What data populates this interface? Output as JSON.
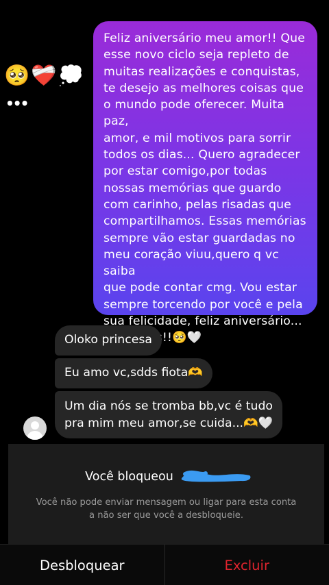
{
  "reactions": {
    "emojis": [
      "🥺",
      "❤️‍🩹",
      "💭"
    ],
    "more": "•••"
  },
  "outgoing_message": {
    "text": "Feliz aniversário meu amor!! Que\nesse novo ciclo seja repleto de\nmuitas realizações e conquistas,\nte desejo as melhores coisas que\no mundo pode oferecer. Muita paz,\namor, e mil motivos para sorrir\ntodos os dias... Quero agradecer\npor estar comigo,por todas\nnossas memórias que guardo\ncom carinho, pelas risadas que\ncompartilhamos. Essas memórias\nsempre vão estar guardadas no\nmeu coração viuu,quero q vc saiba\nque pode contar cmg. Vou estar\nsempre torcendo por você e pela\nsua felicidade, feliz aniversário...\nSaudades!!🥺🤍",
    "gradient_top": "#9a2bd8",
    "gradient_bottom": "#5a44ee"
  },
  "incoming_messages": [
    {
      "text": "Oloko princesa"
    },
    {
      "text": "Eu amo vc,sdds fiota🫶"
    },
    {
      "text": "Um dia nós  se tromba bb,vc é tudo\npra mim meu amor,se cuida...🫶🤍"
    }
  ],
  "blocked_notice": {
    "title": "Você bloqueou",
    "description": "Você não pode enviar mensagem ou ligar para esta conta\na não ser que você a desbloqueie.",
    "scribble_color": "#3b9bf2"
  },
  "actions": {
    "unblock_label": "Desbloquear",
    "delete_label": "Excluir",
    "delete_color": "#e0242e"
  }
}
